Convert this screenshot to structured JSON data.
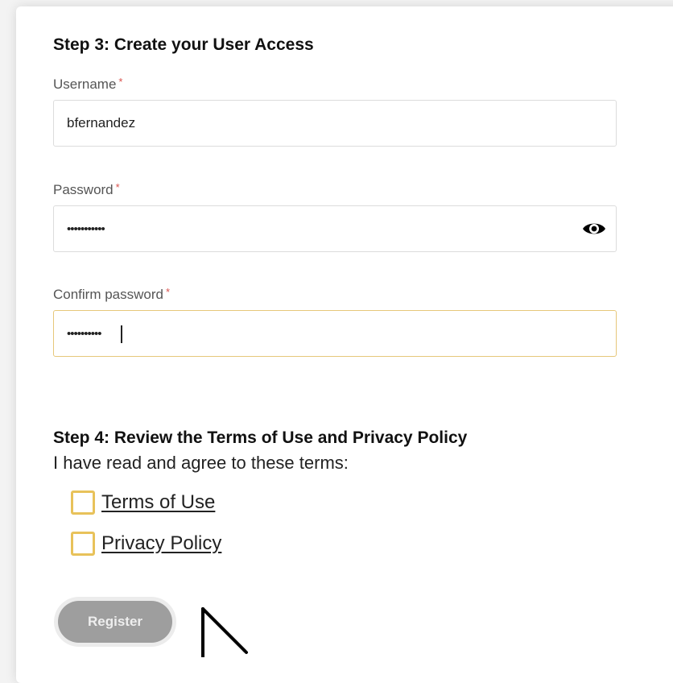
{
  "step3": {
    "title": "Step 3: Create your User Access",
    "username": {
      "label": "Username",
      "required_mark": "*",
      "value": "bfernandez"
    },
    "password": {
      "label": "Password",
      "required_mark": "*",
      "value": "•••••••••••",
      "toggle_icon": "eye-icon"
    },
    "confirm_password": {
      "label": "Confirm password",
      "required_mark": "*",
      "value": "••••••••••"
    }
  },
  "step4": {
    "title": "Step 4: Review the Terms of Use and Privacy Policy",
    "agree_text": "I have read and agree to these terms:",
    "terms": [
      {
        "label": "Terms of Use",
        "checked": false
      },
      {
        "label": "Privacy Policy",
        "checked": false
      }
    ]
  },
  "register": {
    "label": "Register",
    "enabled": false
  },
  "colors": {
    "checkbox_border": "#e8c25a",
    "focus_border": "#e6c77a",
    "required": "#d9534f",
    "button_disabled": "#9e9e9e"
  }
}
